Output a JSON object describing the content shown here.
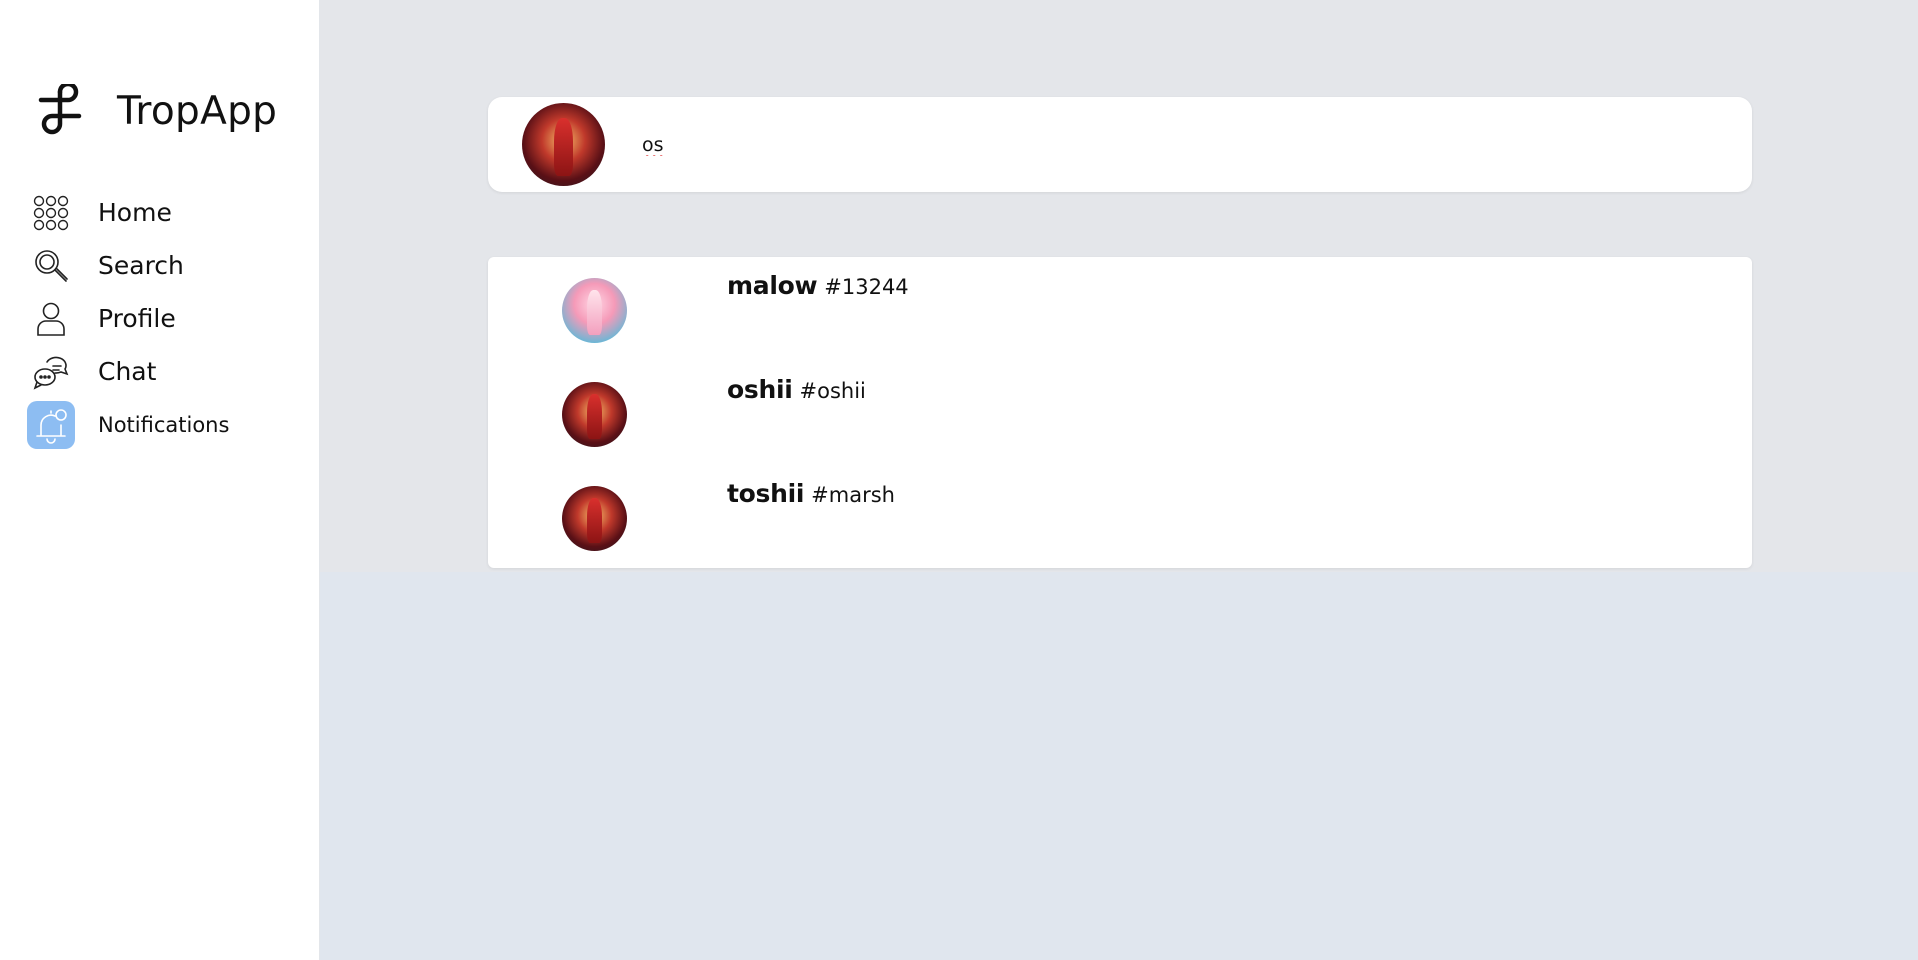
{
  "app": {
    "title": "TropApp"
  },
  "sidebar": {
    "items": [
      {
        "label": "Home",
        "icon": "grid-dots-icon",
        "active": false
      },
      {
        "label": "Search",
        "icon": "search-icon",
        "active": false
      },
      {
        "label": "Profile",
        "icon": "user-icon",
        "active": false
      },
      {
        "label": "Chat",
        "icon": "chat-bubbles-icon",
        "active": false
      },
      {
        "label": "Notifications",
        "icon": "bell-icon",
        "active": true
      }
    ]
  },
  "search": {
    "query": "os"
  },
  "results": [
    {
      "name": "malow",
      "tag": "#13244",
      "avatar": "pink-anime-avatar"
    },
    {
      "name": "oshii",
      "tag": "#oshii",
      "avatar": "red-anime-avatar"
    },
    {
      "name": "toshii",
      "tag": "#marsh",
      "avatar": "red-anime-avatar"
    }
  ],
  "colors": {
    "active_nav_bg": "#8dbdf2",
    "page_bg": "#e0e6ee",
    "card_bg": "#ffffff"
  }
}
